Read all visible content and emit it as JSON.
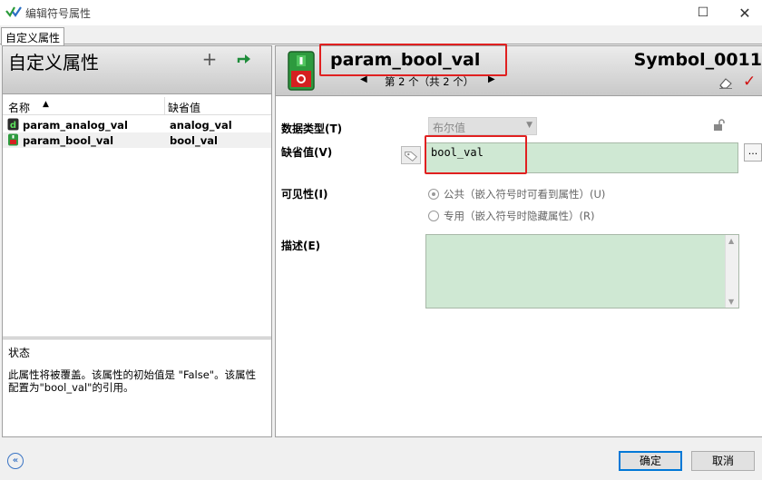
{
  "window": {
    "title": "编辑符号属性",
    "maximize_icon": "maximize-icon",
    "close_icon": "close-icon"
  },
  "tabs": [
    {
      "label": "自定义属性"
    }
  ],
  "left_panel": {
    "heading": "自定义属性",
    "add_label": "+",
    "columns": {
      "name": "名称",
      "default": "缺省值"
    },
    "rows": [
      {
        "name": "param_analog_val",
        "default": "analog_val",
        "icon": "analog-param-icon"
      },
      {
        "name": "param_bool_val",
        "default": "bool_val",
        "icon": "bool-param-icon"
      }
    ],
    "status": {
      "title": "状态",
      "text": "此属性将被覆盖。该属性的初始值是 \"False\"。该属性配置为\"bool_val\"的引用。"
    }
  },
  "right_panel": {
    "param_name": "param_bool_val",
    "symbol_name": "Symbol_0011",
    "nav_text": "第 2 个（共 2 个）",
    "fields": {
      "type_label": "数据类型(T)",
      "type_value": "布尔值",
      "default_label": "缺省值(V)",
      "default_value": "bool_val",
      "browse_label": "...",
      "visibility_label": "可见性(I)",
      "radio_public": "公共（嵌入符号时可看到属性）(U)",
      "radio_private": "专用（嵌入符号时隐藏属性）(R)",
      "description_label": "描述(E)"
    }
  },
  "buttons": {
    "ok": "确定",
    "cancel": "取消",
    "collapse": "«"
  },
  "colors": {
    "highlight_red": "#e02020",
    "input_green": "#cfe8d3",
    "accent_blue": "#0078d7"
  }
}
